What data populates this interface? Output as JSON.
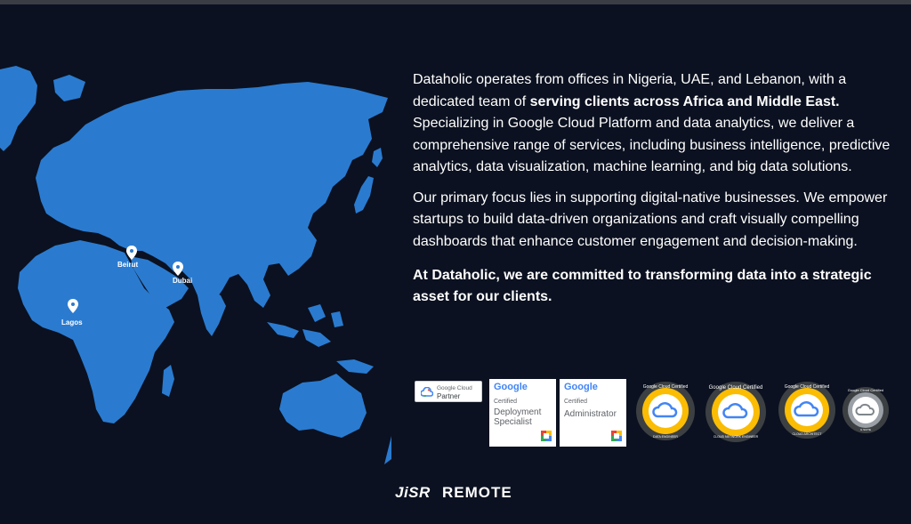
{
  "map": {
    "locations": [
      {
        "label": "Beirut"
      },
      {
        "label": "Dubai"
      },
      {
        "label": "Lagos"
      }
    ],
    "land_color": "#2a7bd0",
    "pin_color": "#ffffff"
  },
  "content": {
    "para1_start": "Dataholic operates from offices in Nigeria, UAE, and Lebanon, with a dedicated team of ",
    "para1_bold": "serving clients across Africa and Middle East.",
    "para1_end": " Specializing in Google Cloud Platform and data analytics, we deliver a comprehensive range of services, including business intelligence, predictive analytics, data visualization, machine learning, and big data solutions.",
    "para2": "Our primary focus lies in supporting digital-native businesses. We empower startups to build data-driven organizations and craft visually compelling dashboards that enhance customer engagement and decision-making.",
    "closing": "At Dataholic, we are committed to transforming data into a strategic asset for our clients."
  },
  "badges": {
    "partner": {
      "line1": "Google Cloud",
      "line2": "Partner"
    },
    "cert1": {
      "brand": "Google",
      "small": "Certified",
      "title": "Deployment Specialist"
    },
    "cert2": {
      "brand": "Google",
      "small": "Certified",
      "title": "Administrator"
    },
    "round": [
      {
        "top": "Google Cloud Certified",
        "bottom": "DATA ENGINEER"
      },
      {
        "top": "Google Cloud Certified",
        "bottom": "CLOUD NETWORK ENGINEER"
      },
      {
        "top": "Google Cloud Certified",
        "bottom": "CLOUD ARCHITECT"
      },
      {
        "top": "Google Cloud Certified",
        "bottom": "G SUITE"
      }
    ]
  },
  "footer": {
    "brand_mark": "JiSR",
    "brand_text": "REMOTE"
  }
}
